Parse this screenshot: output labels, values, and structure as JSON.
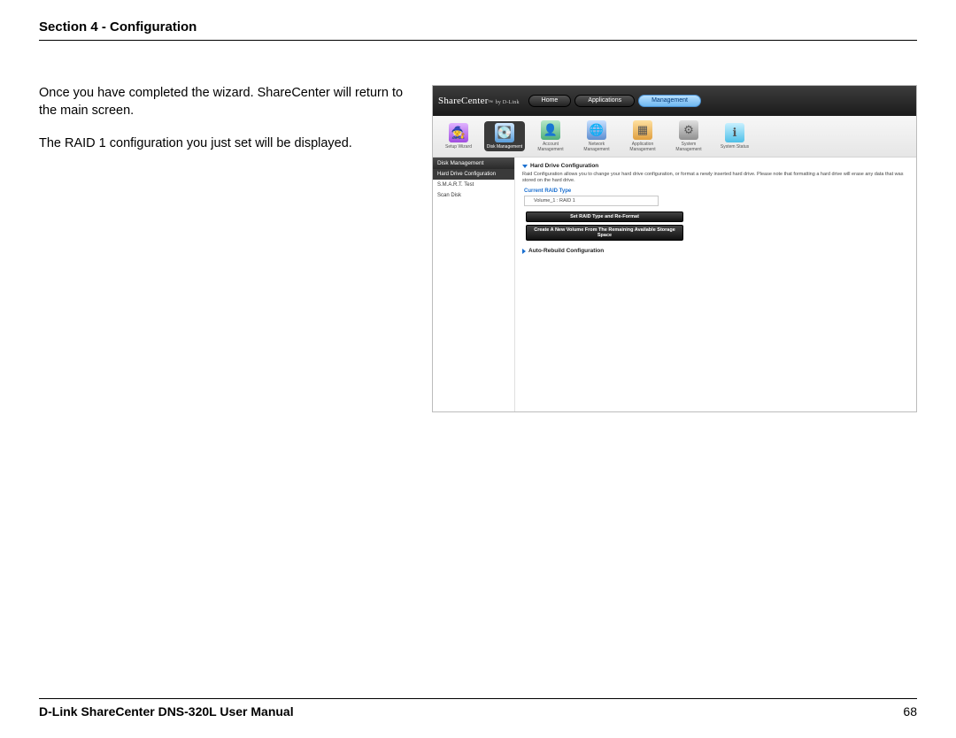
{
  "header": {
    "title": "Section 4 - Configuration"
  },
  "body": {
    "para1": "Once you have completed the wizard. ShareCenter will return to the main screen.",
    "para2": "The RAID 1 configuration you just set will be displayed."
  },
  "footer": {
    "manual": "D-Link ShareCenter DNS-320L User Manual",
    "page": "68"
  },
  "ss": {
    "brand": "ShareCenter",
    "brand_tm": "™",
    "brand_sub": "by D-Link",
    "nav": {
      "home": "Home",
      "apps": "Applications",
      "mgmt": "Management"
    },
    "icons": {
      "wizard": "Setup Wizard",
      "disk": "Disk Management",
      "account": "Account Management",
      "network": "Network Management",
      "app": "Application Management",
      "system": "System Management",
      "status": "System Status"
    },
    "side": {
      "header": "Disk Management",
      "items": [
        "Hard Drive Configuration",
        "S.M.A.R.T. Test",
        "Scan Disk"
      ]
    },
    "panel": {
      "hdc_title": "Hard Drive Configuration",
      "hdc_desc": "Raid Configuration allows you to change your hard drive configuration, or format a newly inserted hard drive. Please note that formatting a hard drive will erase any data that was stored on the hard drive.",
      "curr_label": "Current RAID Type",
      "curr_value": "Volume_1 : RAID 1",
      "btn1": "Set RAID Type and Re-Format",
      "btn2": "Create A New Volume From The Remaining Available Storage Space",
      "arc_title": "Auto-Rebuild Configuration"
    }
  }
}
